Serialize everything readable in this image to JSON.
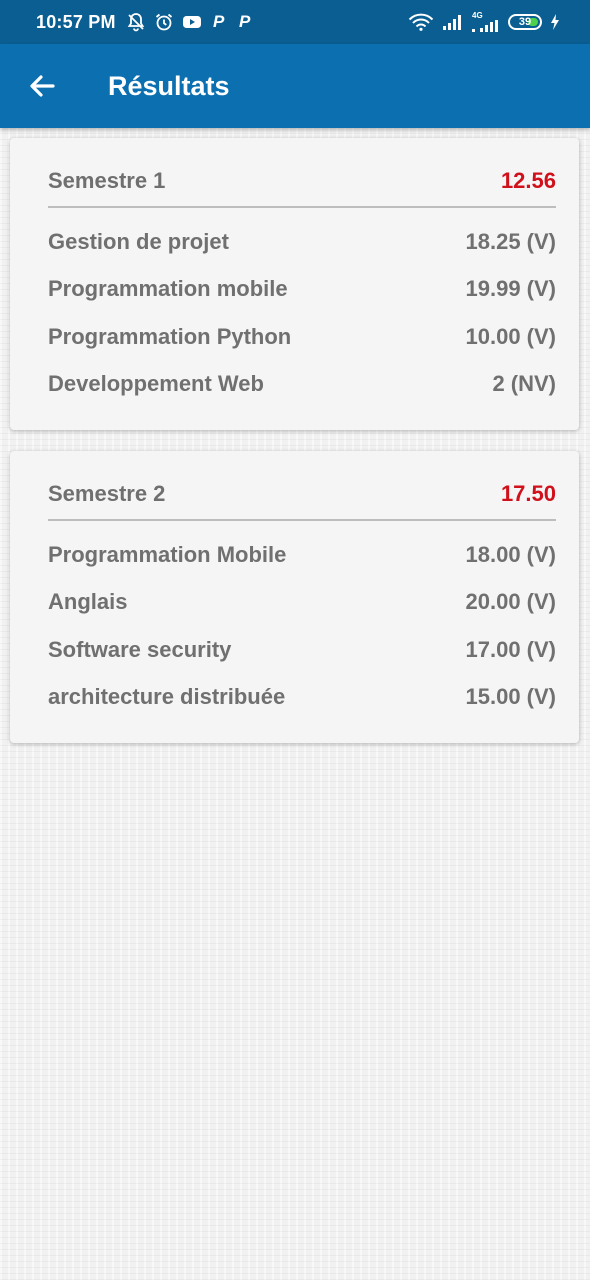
{
  "status_bar": {
    "time": "10:57 PM",
    "network_label": "4G",
    "battery": "39"
  },
  "app_bar": {
    "title": "Résultats",
    "back_icon": "arrow-back-icon"
  },
  "colors": {
    "status_bar_bg": "#0a5e92",
    "app_bar_bg": "#0b6fb0",
    "average_red": "#d0101a",
    "text_gray": "#707070"
  },
  "semesters": [
    {
      "title": "Semestre 1",
      "average": "12.56",
      "courses": [
        {
          "name": "Gestion de projet",
          "grade": "18.25 (V)"
        },
        {
          "name": "Programmation mobile",
          "grade": "19.99 (V)"
        },
        {
          "name": "Programmation Python",
          "grade": "10.00 (V)"
        },
        {
          "name": "Developpement Web",
          "grade": "2 (NV)"
        }
      ]
    },
    {
      "title": "Semestre 2",
      "average": "17.50",
      "courses": [
        {
          "name": "Programmation Mobile",
          "grade": "18.00 (V)"
        },
        {
          "name": "Anglais",
          "grade": "20.00 (V)"
        },
        {
          "name": "Software security",
          "grade": "17.00 (V)"
        },
        {
          "name": "architecture distribuée",
          "grade": "15.00 (V)"
        }
      ]
    }
  ]
}
